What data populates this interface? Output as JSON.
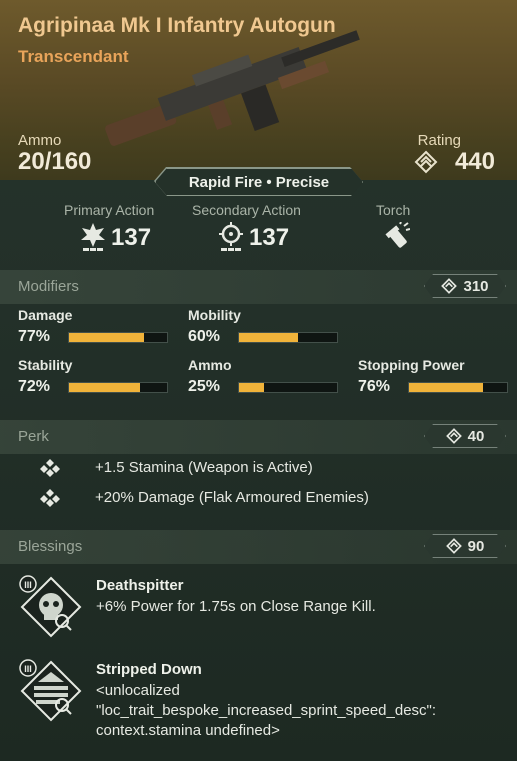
{
  "weapon": {
    "name": "Agripinaa Mk I Infantry Autogun",
    "rarity": "Transcendant",
    "ammo_label": "Ammo",
    "ammo_value": "20/160",
    "rating_label": "Rating",
    "rating_value": "440",
    "fire_modes": "Rapid Fire • Precise"
  },
  "actions": {
    "primary_label": "Primary Action",
    "primary_value": "137",
    "secondary_label": "Secondary Action",
    "secondary_value": "137",
    "torch_label": "Torch"
  },
  "modifiers": {
    "title": "Modifiers",
    "score": "310",
    "items": [
      {
        "name": "Damage",
        "value": "77%",
        "fraction": 0.77
      },
      {
        "name": "Mobility",
        "value": "60%",
        "fraction": 0.6
      },
      {
        "name": "Stability",
        "value": "72%",
        "fraction": 0.72
      },
      {
        "name": "Ammo",
        "value": "25%",
        "fraction": 0.25
      },
      {
        "name": "Stopping Power",
        "value": "76%",
        "fraction": 0.76
      }
    ]
  },
  "perk": {
    "title": "Perk",
    "score": "40",
    "items": [
      {
        "text": "+1.5 Stamina (Weapon is Active)",
        "icon": "perk-diamond-icon"
      },
      {
        "text": "+20% Damage (Flak Armoured Enemies)",
        "icon": "perk-diamond-icon"
      }
    ]
  },
  "blessings": {
    "title": "Blessings",
    "score": "90",
    "items": [
      {
        "name": "Deathspitter",
        "description": "+6% Power for 1.75s on Close Range Kill.",
        "tier": "III",
        "icon": "skull-blessing-icon"
      },
      {
        "name": "Stripped Down",
        "description": "<unlocalized \"loc_trait_bespoke_increased_sprint_speed_desc\": context.stamina undefined>",
        "tier": "III",
        "icon": "stripped-blessing-icon"
      }
    ]
  },
  "colors": {
    "accent": "#f0b33a",
    "title": "#f0c890",
    "rarity": "#e9a45a"
  }
}
